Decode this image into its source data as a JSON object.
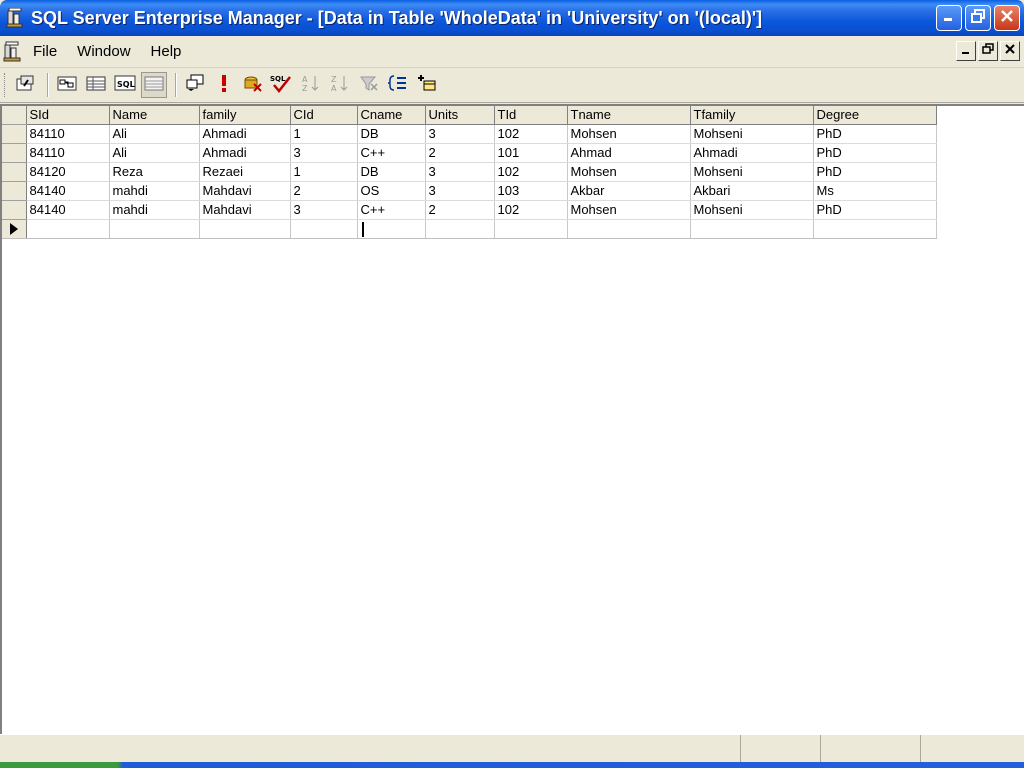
{
  "window": {
    "title": "SQL Server Enterprise Manager - [Data in Table 'WholeData' in 'University' on '(local)']",
    "icons": {
      "app": "sql-server-icon",
      "minimize": "minimize-icon",
      "maximize": "restore-icon",
      "close": "close-icon"
    }
  },
  "menubar": {
    "items": [
      {
        "label": "File"
      },
      {
        "label": "Window"
      },
      {
        "label": "Help"
      }
    ]
  },
  "toolbar": {
    "icons": [
      "properties-icon",
      "show-diagram-pane-icon",
      "show-grid-pane-icon",
      "show-sql-pane-icon",
      "show-results-pane-icon",
      "change-query-type-icon",
      "run-icon",
      "cancel-query-icon",
      "verify-sql-icon",
      "sort-ascending-icon",
      "sort-descending-icon",
      "remove-filter-icon",
      "use-group-by-icon",
      "add-table-icon"
    ]
  },
  "grid": {
    "columns": [
      "SId",
      "Name",
      "family",
      "CId",
      "Cname",
      "Units",
      "TId",
      "Tname",
      "Tfamily",
      "Degree"
    ],
    "rows": [
      [
        "84110",
        "Ali",
        "Ahmadi",
        "1",
        "DB",
        "3",
        "102",
        "Mohsen",
        "Mohseni",
        "PhD"
      ],
      [
        "84110",
        "Ali",
        "Ahmadi",
        "3",
        "C++",
        "2",
        "101",
        "Ahmad",
        "Ahmadi",
        "PhD"
      ],
      [
        "84120",
        "Reza",
        "Rezaei",
        "1",
        "DB",
        "3",
        "102",
        "Mohsen",
        "Mohseni",
        "PhD"
      ],
      [
        "84140",
        "mahdi",
        "Mahdavi",
        "2",
        "OS",
        "3",
        "103",
        "Akbar",
        "Akbari",
        "Ms"
      ],
      [
        "84140",
        "mahdi",
        "Mahdavi",
        "3",
        "C++",
        "2",
        "102",
        "Mohsen",
        "Mohseni",
        "PhD"
      ]
    ]
  },
  "colors": {
    "titlebar": "#0a5ee0",
    "chrome": "#ece9d8",
    "grid_background": "#ffffff"
  }
}
